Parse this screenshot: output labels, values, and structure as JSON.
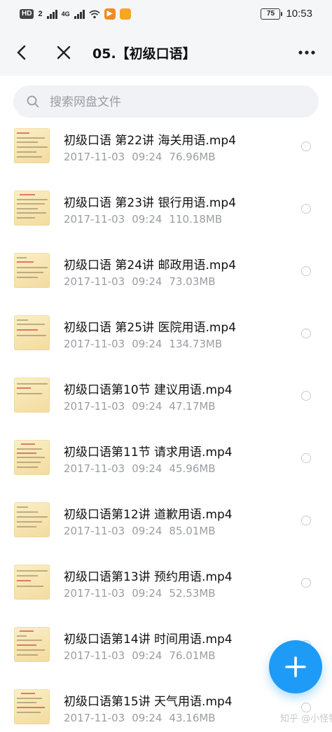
{
  "status_bar": {
    "hd_label": "HD",
    "sim_slot": "2",
    "network_type": "4G",
    "battery_level": "75",
    "time": "10:53"
  },
  "header": {
    "title": "05.【初级口语】",
    "back_icon": "back-arrow-icon",
    "close_icon": "close-icon",
    "more_icon": "more-dots-icon"
  },
  "search": {
    "placeholder": "搜索网盘文件",
    "value": ""
  },
  "files": [
    {
      "name": "初级口语 第22讲 海关用语.mp4",
      "date": "2017-11-03",
      "time": "09:24",
      "size": "76.96MB"
    },
    {
      "name": "初级口语 第23讲 银行用语.mp4",
      "date": "2017-11-03",
      "time": "09:24",
      "size": "110.18MB"
    },
    {
      "name": "初级口语 第24讲 邮政用语.mp4",
      "date": "2017-11-03",
      "time": "09:24",
      "size": "73.03MB"
    },
    {
      "name": "初级口语 第25讲 医院用语.mp4",
      "date": "2017-11-03",
      "time": "09:24",
      "size": "134.73MB"
    },
    {
      "name": "初级口语第10节 建议用语.mp4",
      "date": "2017-11-03",
      "time": "09:24",
      "size": "47.17MB"
    },
    {
      "name": "初级口语第11节 请求用语.mp4",
      "date": "2017-11-03",
      "time": "09:24",
      "size": "45.96MB"
    },
    {
      "name": "初级口语第12讲 道歉用语.mp4",
      "date": "2017-11-03",
      "time": "09:24",
      "size": "85.01MB"
    },
    {
      "name": "初级口语第13讲 预约用语.mp4",
      "date": "2017-11-03",
      "time": "09:24",
      "size": "52.53MB"
    },
    {
      "name": "初级口语第14讲 时间用语.mp4",
      "date": "2017-11-03",
      "time": "09:24",
      "size": "76.01MB"
    },
    {
      "name": "初级口语第15讲 天气用语.mp4",
      "date": "2017-11-03",
      "time": "09:24",
      "size": "43.16MB"
    }
  ],
  "fab": {
    "icon": "plus-icon"
  },
  "watermark": "知乎 @小怪物",
  "colors": {
    "accent": "#1d9bf6",
    "header_bg": "#f5f6f8",
    "meta_text": "#9b9da3"
  }
}
